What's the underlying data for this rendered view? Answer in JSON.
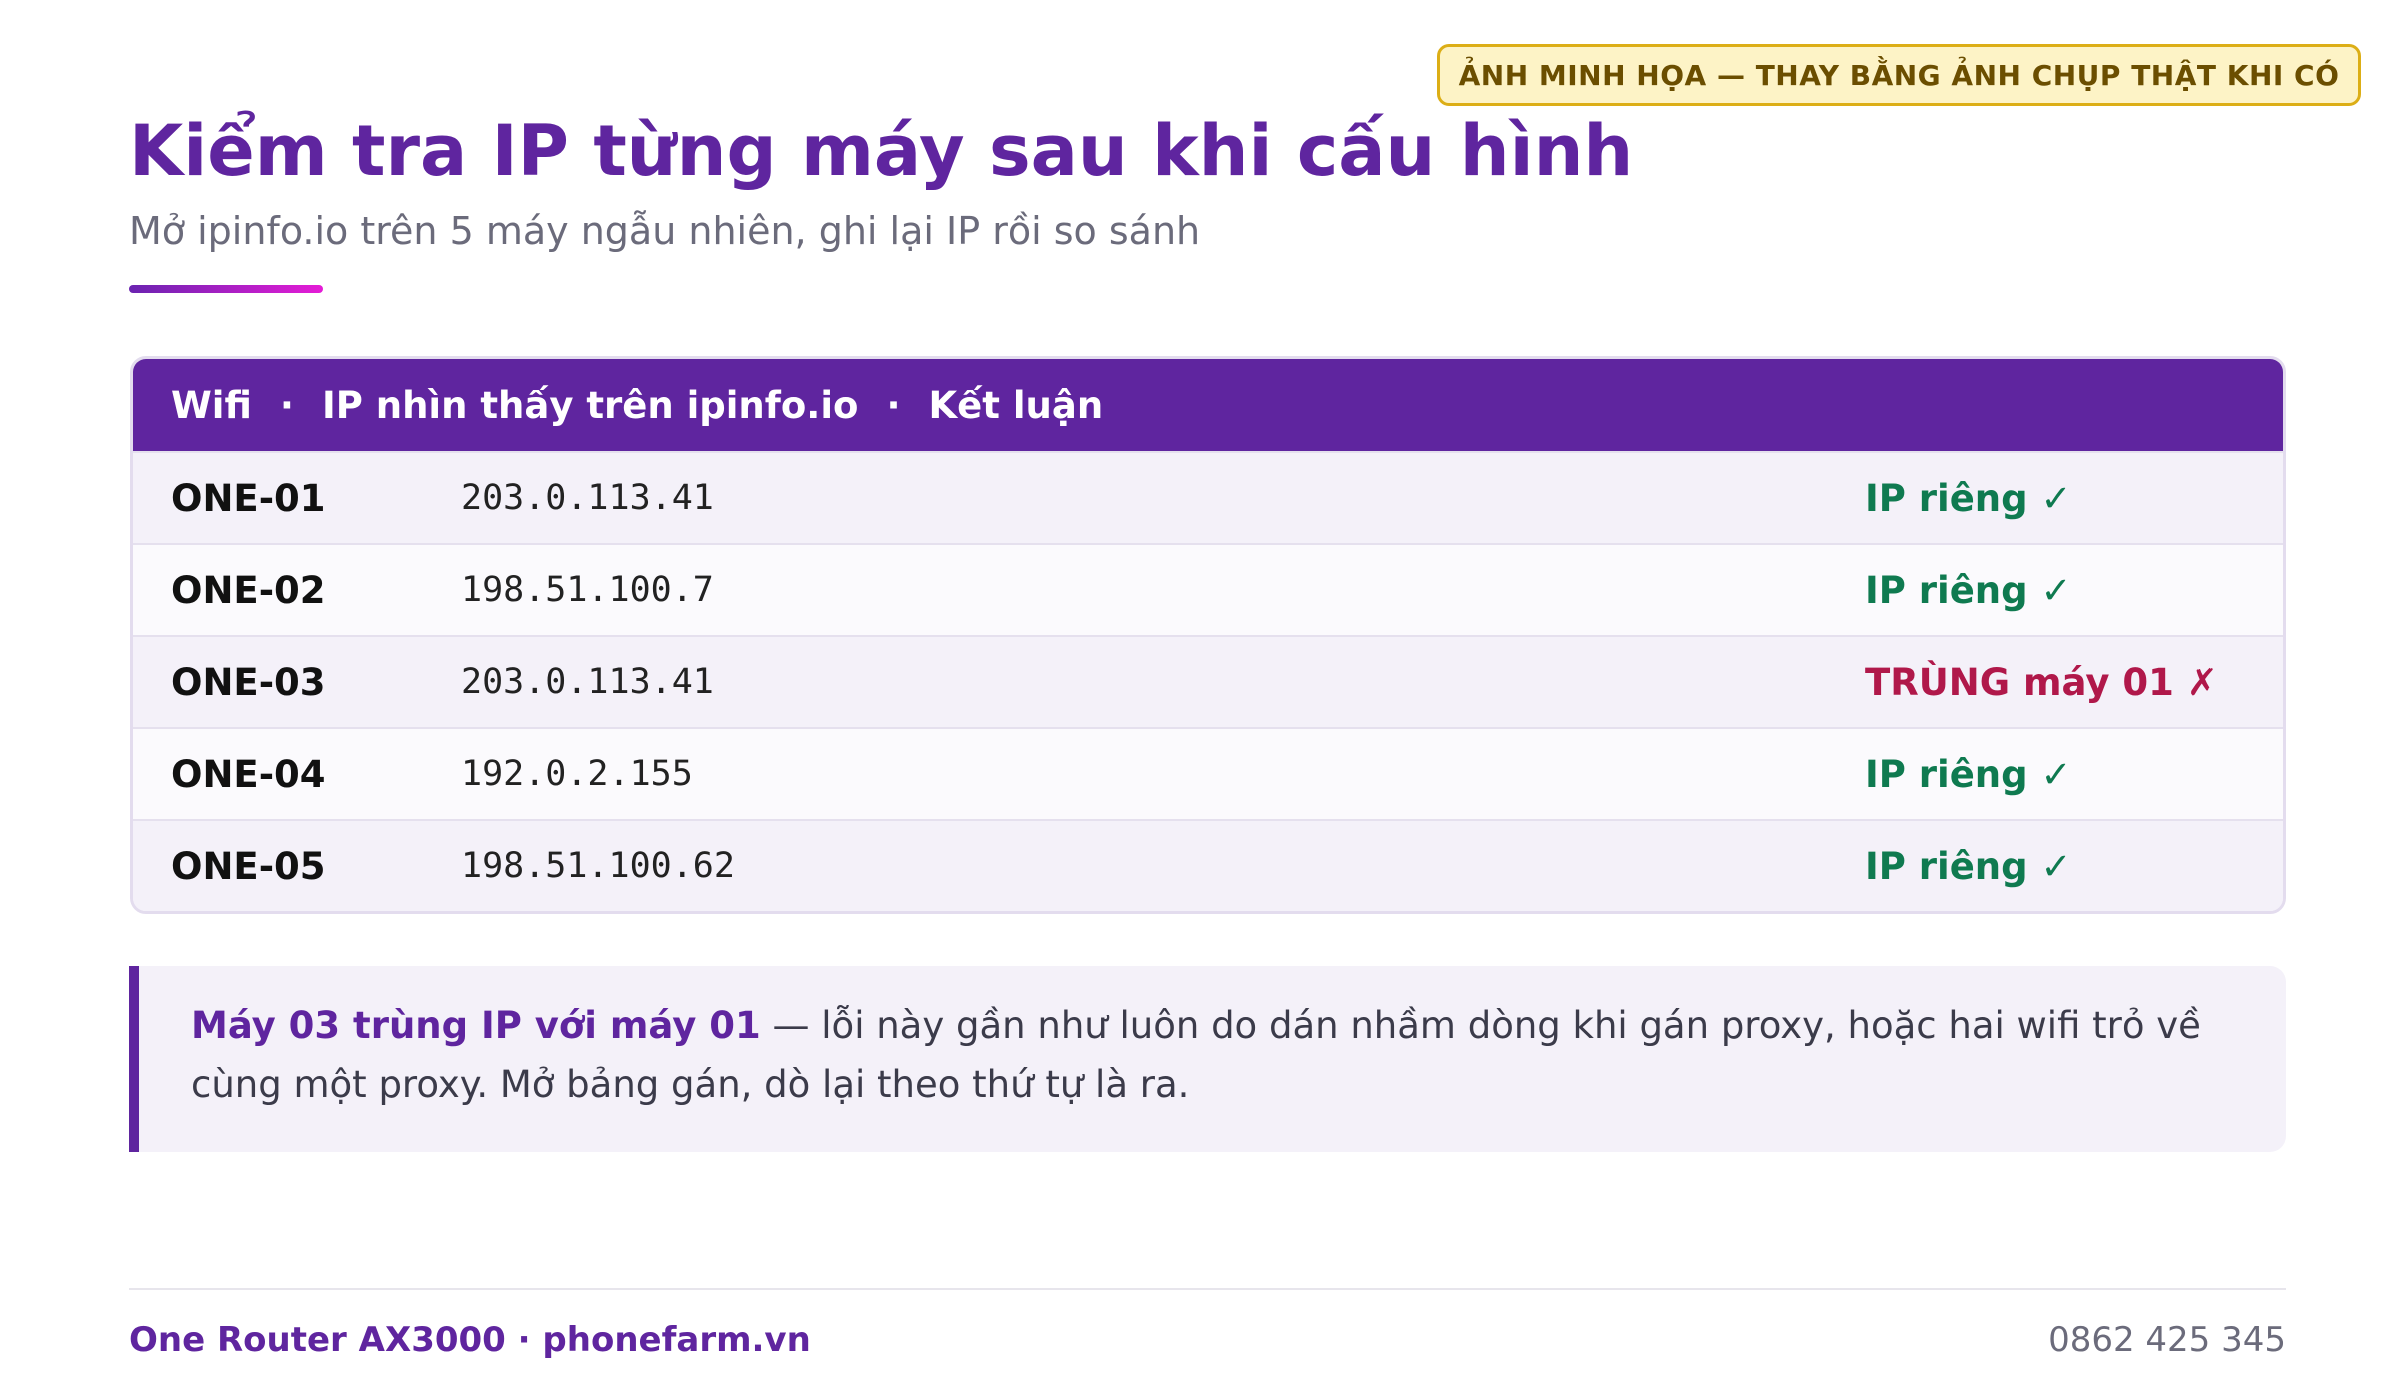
{
  "badge": "ẢNH MINH HỌA — THAY BẰNG ẢNH CHỤP THẬT KHI CÓ",
  "header": {
    "title": "Kiểm tra IP từng máy sau khi cấu hình",
    "subtitle": "Mở ipinfo.io trên 5 máy ngẫu nhiên, ghi lại IP rồi so sánh"
  },
  "table": {
    "columns": [
      "Wifi",
      "IP nhìn thấy trên ipinfo.io",
      "Kết luận"
    ],
    "separator": "·",
    "rows": [
      {
        "wifi": "ONE-01",
        "ip": "203.0.113.41",
        "result": "IP riêng ✓",
        "status": "ok"
      },
      {
        "wifi": "ONE-02",
        "ip": "198.51.100.7",
        "result": "IP riêng ✓",
        "status": "ok"
      },
      {
        "wifi": "ONE-03",
        "ip": "203.0.113.41",
        "result": "TRÙNG máy 01 ✗",
        "status": "bad"
      },
      {
        "wifi": "ONE-04",
        "ip": "192.0.2.155",
        "result": "IP riêng ✓",
        "status": "ok"
      },
      {
        "wifi": "ONE-05",
        "ip": "198.51.100.62",
        "result": "IP riêng ✓",
        "status": "ok"
      }
    ]
  },
  "note": {
    "highlight": "Máy 03 trùng IP với máy 01",
    "text": " — lỗi này gần như luôn do dán nhầm dòng khi gán proxy, hoặc hai wifi trỏ về cùng một proxy. Mở bảng gán, dò lại theo thứ tự là ra."
  },
  "footer": {
    "brand": "One Router AX3000 · phonefarm.vn",
    "phone": "0862 425 345"
  },
  "colors": {
    "brand": "#5f259f",
    "ok": "#0f7a50",
    "bad": "#b0184a",
    "badge_border": "#dcae16"
  }
}
